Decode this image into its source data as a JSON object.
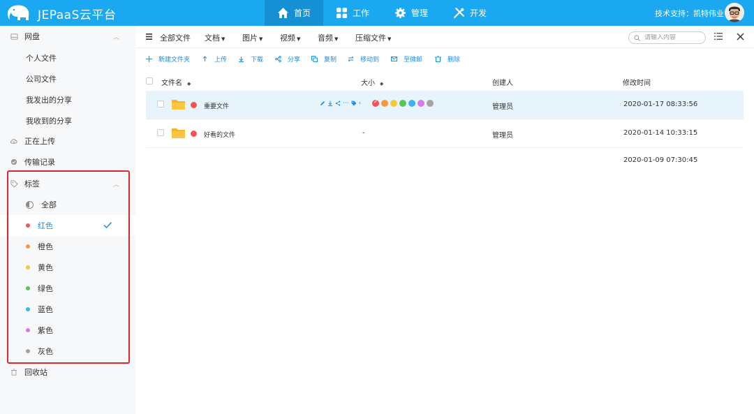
{
  "header": {
    "app_title": "JEPaaS云平台",
    "nav": [
      {
        "label": "首页",
        "icon": "home-icon",
        "active": true
      },
      {
        "label": "工作",
        "icon": "grid-icon",
        "active": false
      },
      {
        "label": "管理",
        "icon": "gear-icon",
        "active": false
      },
      {
        "label": "开发",
        "icon": "tools-icon",
        "active": false
      }
    ],
    "support": "技术支持：凯特伟业"
  },
  "sidebar": {
    "netdisk": "网盘",
    "netdisk_items": [
      "个人文件",
      "公司文件",
      "我发出的分享",
      "我收到的分享"
    ],
    "uploading": "正在上传",
    "transfer": "传输记录",
    "tags_label": "标签",
    "tags": [
      {
        "label": "全部",
        "color": ""
      },
      {
        "label": "红色",
        "color": "#f5525a",
        "selected": true
      },
      {
        "label": "橙色",
        "color": "#f59a3d"
      },
      {
        "label": "黄色",
        "color": "#f5c93d"
      },
      {
        "label": "绿色",
        "color": "#5cc35a"
      },
      {
        "label": "蓝色",
        "color": "#3cb2ee"
      },
      {
        "label": "紫色",
        "color": "#d77ce4"
      },
      {
        "label": "灰色",
        "color": "#a4a4a4"
      }
    ],
    "recycle": "回收站"
  },
  "toolbar": {
    "all_files": "全部文件",
    "filters": [
      "文档",
      "图片",
      "视频",
      "音频",
      "压缩文件"
    ],
    "search_placeholder": "请输入内容"
  },
  "actions": [
    "新建文件夹",
    "上传",
    "下载",
    "分享",
    "复制",
    "移动到",
    "至微邮",
    "删除"
  ],
  "table": {
    "headers": {
      "name": "文件名",
      "size": "大小",
      "creator": "创建人",
      "modified": "修改时间"
    },
    "rows": [
      {
        "name": "重要文件",
        "size": "",
        "creator": "管理员",
        "modified": "2020-01-17 08:33:56",
        "tag_color": "#f5525a"
      },
      {
        "name": "好看的文件",
        "size": "-",
        "creator": "管理员",
        "modified": "2020-01-14 10:33:15",
        "tag_color": "#f5525a"
      }
    ],
    "extra_date": "2020-01-09 07:30:45"
  },
  "tag_picker_colors": [
    "#f5525a",
    "#f59a3d",
    "#f5c93d",
    "#5cc35a",
    "#3cb2ee",
    "#d77ce4",
    "#a4a4a4"
  ]
}
